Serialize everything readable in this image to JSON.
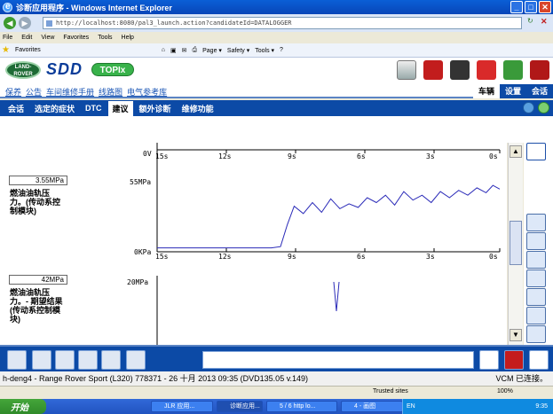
{
  "window": {
    "title": "诊断应用程序 - Windows Internet Explorer"
  },
  "address": {
    "url": "http://localhost:8080/pal3_launch.action?candidateId=DATALOGGER"
  },
  "menu": [
    "File",
    "Edit",
    "View",
    "Favorites",
    "Tools",
    "Help"
  ],
  "favbar": {
    "favorites": "Favorites",
    "page": "Page ▾",
    "safety": "Safety ▾",
    "tools": "Tools ▾"
  },
  "brand": {
    "landrover": "LAND-ROVER",
    "sdd": "SDD",
    "topix": "TOPIx"
  },
  "nav_links": [
    "保养",
    "公告",
    "车间维修手册",
    "线路图",
    "电气参考库"
  ],
  "nav_right": [
    {
      "label": "车辆",
      "active": true
    },
    {
      "label": "设置",
      "active": false
    },
    {
      "label": "会话",
      "active": false
    }
  ],
  "tabs": [
    {
      "label": "会话",
      "active": false
    },
    {
      "label": "选定的症状",
      "active": false
    },
    {
      "label": "DTC",
      "active": false
    },
    {
      "label": "建议",
      "active": true
    },
    {
      "label": "额外诊断",
      "active": false
    },
    {
      "label": "维修功能",
      "active": false
    }
  ],
  "plot1": {
    "value": "3.55MPa",
    "label": "燃油油轨压力。(传动系控制模块)",
    "y_top": "55MPa",
    "y_mid": "0V",
    "y_bottom": "0KPa",
    "x_ticks": [
      "15s",
      "12s",
      "9s",
      "6s",
      "3s",
      "0s"
    ]
  },
  "plot2": {
    "value": "42MPa",
    "label": "燃油油轨压力。- 期望结果 (传动系控制模块)",
    "y_top": "20MPa"
  },
  "chart_data": [
    {
      "type": "line",
      "title": "",
      "ylabel": "燃油油轨压力。(传动系控制模块)",
      "xlabel": "",
      "ylim": [
        0,
        55
      ],
      "x_ticks": [
        "15s",
        "12s",
        "9s",
        "6s",
        "3s",
        "0s"
      ],
      "x": [
        15,
        14,
        13,
        12,
        11,
        10,
        9.6,
        9.3,
        9,
        8.6,
        8.2,
        7.8,
        7.4,
        7.0,
        6.6,
        6.2,
        5.8,
        5.4,
        5.0,
        4.6,
        4.2,
        3.8,
        3.4,
        3.0,
        2.6,
        2.2,
        1.8,
        1.4,
        1.0,
        0.6,
        0.3,
        0
      ],
      "series": [
        {
          "values": [
            1,
            1,
            1,
            1,
            1,
            1,
            2,
            20,
            35,
            29,
            38,
            30,
            41,
            33,
            37,
            34,
            42,
            38,
            44,
            36,
            47,
            40,
            44,
            38,
            47,
            42,
            48,
            44,
            50,
            46,
            52,
            49
          ]
        }
      ]
    },
    {
      "type": "line",
      "title": "",
      "ylabel": "燃油油轨压力。- 期望结果 (传动系控制模块)",
      "xlabel": "",
      "ylim": [
        0,
        20
      ],
      "series": [
        {
          "values": [
            20,
            11,
            20
          ]
        }
      ]
    }
  ],
  "status": {
    "text": "h-deng4 - Range Rover Sport (L320) 778371 - 26 十月 2013 09:35 (DVD135.05 v.149)",
    "vcm": "VCM 已连接。"
  },
  "ie_status": {
    "zone": "Trusted sites",
    "zoom": "100%"
  },
  "taskbar": {
    "start": "开始",
    "tasks": [
      "JLR 应用...",
      "诊断应用...",
      "5 / 6 http lo...",
      "4 - 画图"
    ],
    "time": "9:35",
    "lang": "EN"
  }
}
